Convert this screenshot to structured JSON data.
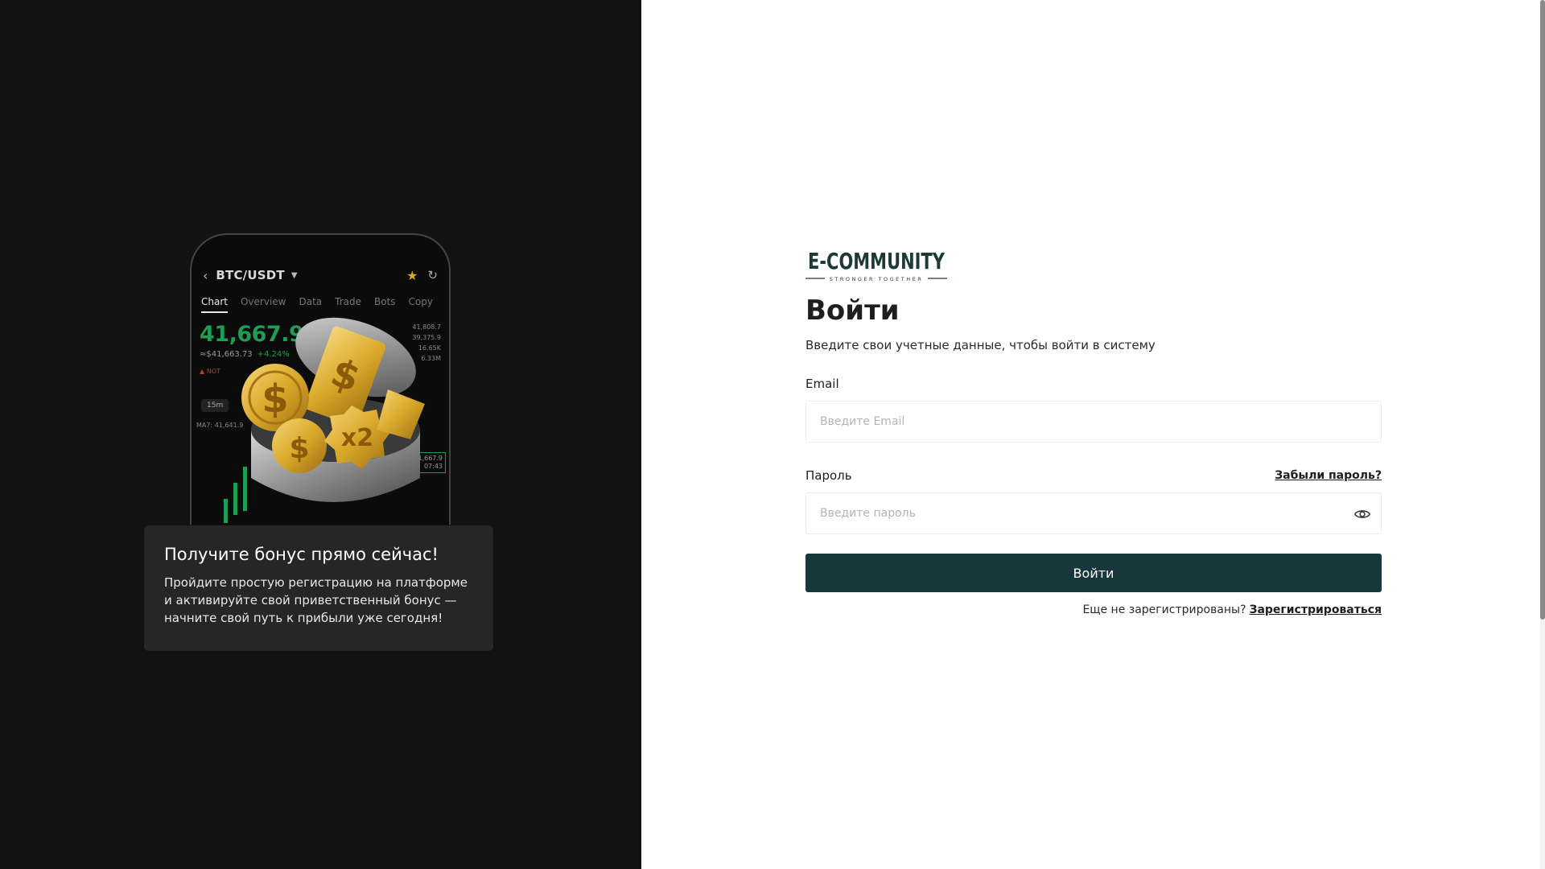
{
  "promo": {
    "phone": {
      "pair": "BTC/USDT",
      "tabs": [
        "Chart",
        "Overview",
        "Data",
        "Trade",
        "Bots",
        "Copy"
      ],
      "price": "41,667.9",
      "price_sub": "≈$41,663.73",
      "price_change": "+4.24%",
      "stats": [
        "41,808.7",
        "39,375.9",
        "16.65K",
        "6.33M"
      ],
      "hot_tag": "NOT",
      "interval": "15m",
      "ma_label": "MA7: 41,641.9",
      "price_tag_top": "41,667.9",
      "price_tag_bottom": "07:43"
    },
    "title": "Получите бонус прямо сейчас!",
    "text": "Пройдите простую регистрацию на платформе и активируйте свой приветственный бонус — начните свой путь к прибыли уже сегодня!"
  },
  "logo": {
    "name": "E-COMMUNITY",
    "tagline": "STRONGER TOGETHER"
  },
  "form": {
    "title": "Войти",
    "subtitle": "Введите свои учетные данные, чтобы войти в систему",
    "email_label": "Email",
    "email_placeholder": "Введите Email",
    "password_label": "Пароль",
    "forgot_label": "Забыли пароль?",
    "password_placeholder": "Введите пароль",
    "submit_label": "Войти",
    "register_prompt": "Еще не зарегистрированы?",
    "register_link": "Зарегистрироваться"
  },
  "colors": {
    "left_bg": "#121212",
    "card_bg": "#262626",
    "button_bg": "#17373a",
    "brand": "#1c3a36",
    "gold": "#d9a82a",
    "chart_green": "#1f9d55"
  },
  "icons": {
    "password_toggle": "eye-icon",
    "back": "chevron-left-icon",
    "favorite": "star-icon",
    "refresh": "refresh-icon"
  }
}
